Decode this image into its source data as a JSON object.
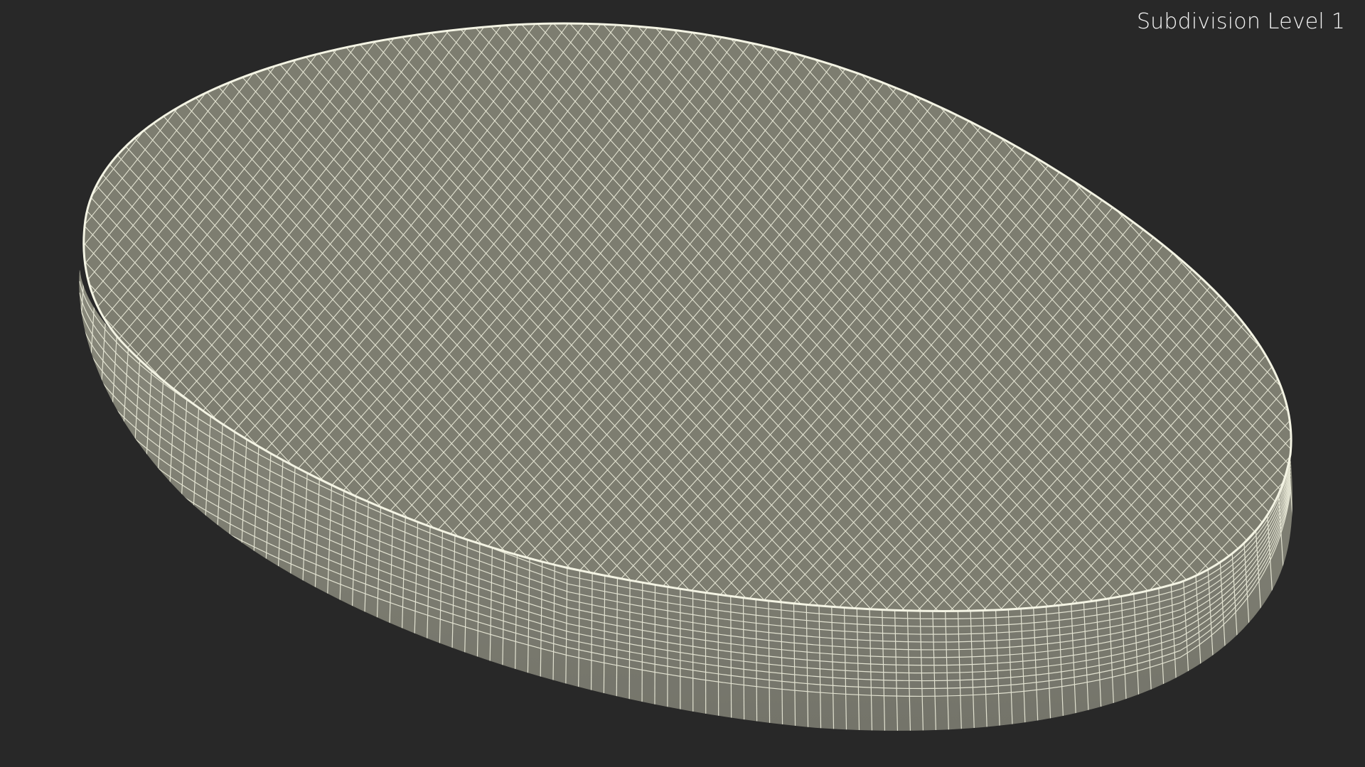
{
  "viewport": {
    "subdivision_label": "Subdivision Level 1"
  },
  "colors": {
    "background": "#282828",
    "surface": "#7d7d70",
    "wire": "#eeeedc",
    "label": "#f2f2f2"
  }
}
